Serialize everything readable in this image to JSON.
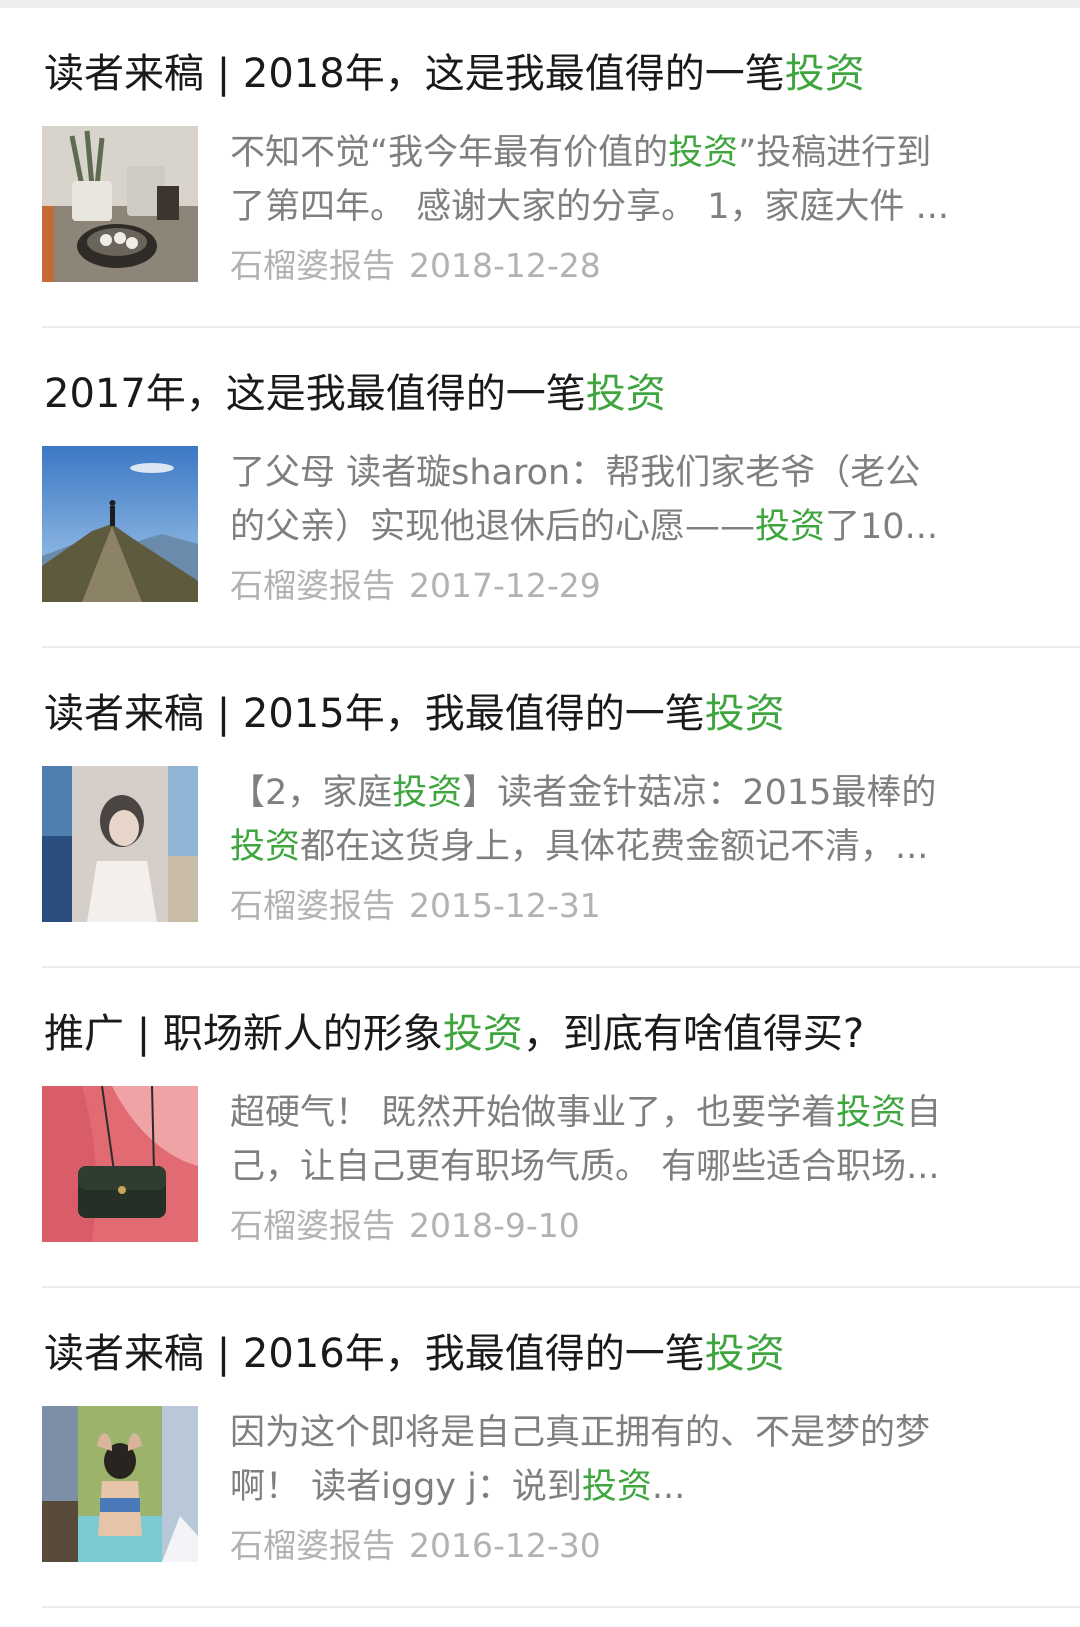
{
  "articles": [
    {
      "title_pre": "读者来稿 | 2018年，这是我最值得的一笔",
      "title_hl": "投资",
      "title_post": "",
      "line1_pre": "不知不觉“我今年最有价值的",
      "line1_hl": "投资",
      "line1_post": "”投稿进行到",
      "line2_pre": "了第四年。 感谢大家的分享。 1，家庭大件 ...",
      "line2_hl": "",
      "line2_post": "",
      "source": "石榴婆报告",
      "date": "2018-12-28",
      "thumb": "tea-cup-photo"
    },
    {
      "title_pre": "2017年，这是我最值得的一笔",
      "title_hl": "投资",
      "title_post": "",
      "line1_pre": "了父母 读者璇sharon：帮我们家老爷（老公",
      "line1_hl": "",
      "line1_post": "",
      "line2_pre": "的父亲）实现他退休后的心愿——",
      "line2_hl": "投资",
      "line2_post": "了10...",
      "source": "石榴婆报告",
      "date": "2017-12-29",
      "thumb": "mountain-photo"
    },
    {
      "title_pre": "读者来稿 | 2015年，我最值得的一笔",
      "title_hl": "投资",
      "title_post": "",
      "line1_pre": "【2，家庭",
      "line1_hl": "投资",
      "line1_post": "】读者金针菇凉：2015最棒的",
      "line2_pre": "",
      "line2_hl": "投资",
      "line2_post": "都在这货身上，具体花费金额记不清，...",
      "source": "石榴婆报告",
      "date": "2015-12-31",
      "thumb": "beach-portrait-photo"
    },
    {
      "title_pre": "推广 | 职场新人的形象",
      "title_hl": "投资",
      "title_post": "，到底有啥值得买?",
      "line1_pre": "超硬气！ 既然开始做事业了，也要学着",
      "line1_hl": "投资",
      "line1_post": "自",
      "line2_pre": "己，让自己更有职场气质。 有哪些适合职场...",
      "line2_hl": "",
      "line2_post": "",
      "source": "石榴婆报告",
      "date": "2018-9-10",
      "thumb": "handbag-photo"
    },
    {
      "title_pre": "读者来稿 | 2016年，我最值得的一笔",
      "title_hl": "投资",
      "title_post": "",
      "line1_pre": "因为这个即将是自己真正拥有的、不是梦的梦",
      "line1_hl": "",
      "line1_post": "",
      "line2_pre": "啊！ 读者iggy j：说到",
      "line2_hl": "投资",
      "line2_post": "...",
      "source": "石榴婆报告",
      "date": "2016-12-30",
      "thumb": "travel-collage-photo"
    }
  ],
  "colors": {
    "highlight": "#3fa63f",
    "title": "#1a1a1a",
    "digest": "#7f7f7f",
    "meta": "#b2b2b2"
  }
}
